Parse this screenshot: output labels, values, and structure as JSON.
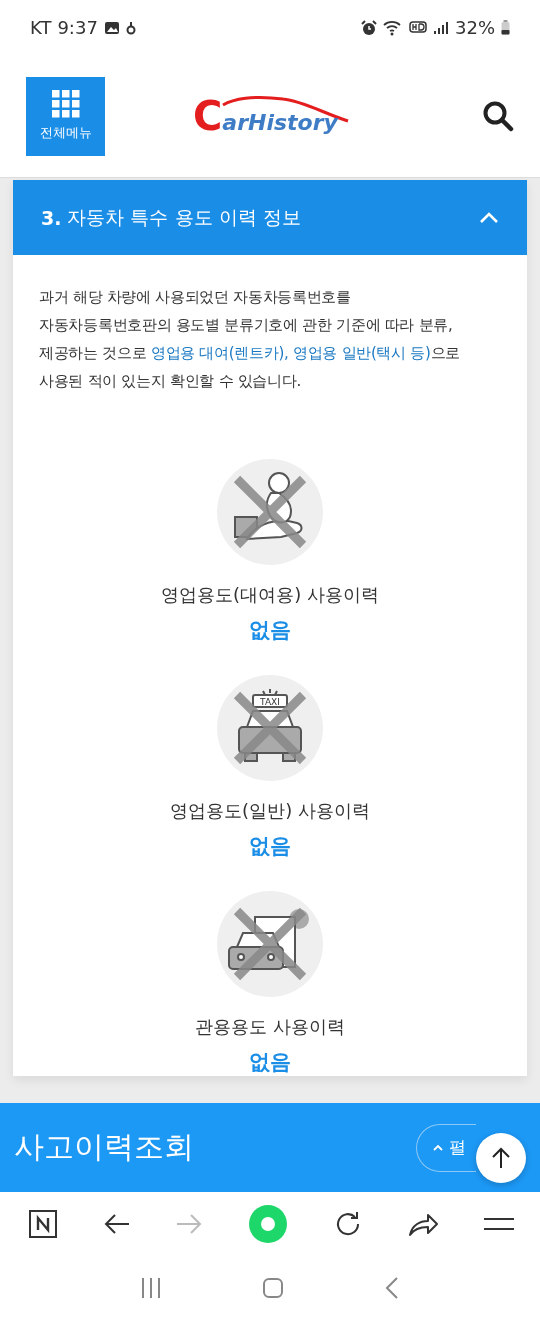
{
  "status_bar": {
    "carrier": "KT",
    "time": "9:37",
    "battery": "32%"
  },
  "header": {
    "menu_label": "전체메뉴",
    "logo": {
      "initial": "C",
      "rest": "arHistory"
    }
  },
  "section": {
    "number": "3.",
    "title": "자동차 특수 용도 이력 정보",
    "expanded": true,
    "description": [
      [
        {
          "text": "과거 해당 차량에 사용되었던 자동차등록번호를",
          "highlight": false
        }
      ],
      [
        {
          "text": "자동차등록번호판의 용도별 분류기호에 관한 기준에 따라 분류,",
          "highlight": false
        }
      ],
      [
        {
          "text": "제공하는 것으로 ",
          "highlight": false
        },
        {
          "text": "영업용 대여(렌트카), 영업용 일반(택시 등)",
          "highlight": true
        },
        {
          "text": "으로",
          "highlight": false
        }
      ],
      [
        {
          "text": "사용된 적이 있는지 확인할 수 있습니다.",
          "highlight": false
        }
      ]
    ],
    "items": [
      {
        "kind": "rental",
        "label": "영업용도(대여용) 사용이력",
        "result": "없음"
      },
      {
        "kind": "taxi",
        "sign": "TAXI",
        "label": "영업용도(일반) 사용이력",
        "result": "없음"
      },
      {
        "kind": "official",
        "label": "관용용도 사용이력",
        "result": "없음"
      }
    ]
  },
  "next_section": {
    "title": "사고이력조회",
    "button": "펼"
  }
}
